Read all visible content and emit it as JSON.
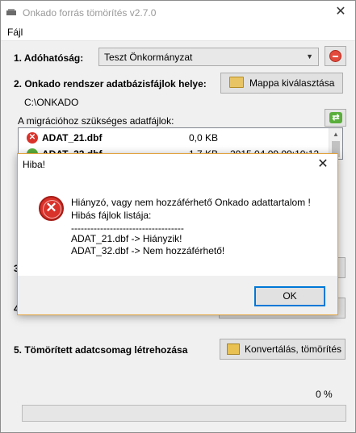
{
  "window": {
    "title": "Onkado forrás tömörítés v2.7.0"
  },
  "menu": {
    "file": "Fájl"
  },
  "step1": {
    "label": "1. Adóhatóság:",
    "selected": "Teszt Önkormányzat"
  },
  "step2": {
    "label": "2. Onkado rendszer adatbázisfájlok helye:",
    "browse_button": "Mappa kiválasztása",
    "path": "C:\\ONKADO"
  },
  "files": {
    "header": "A migrációhoz szükséges adatfájlok:",
    "rows": [
      {
        "name": "ADAT_21.dbf",
        "size": "0,0 KB",
        "date": "",
        "status": "error"
      },
      {
        "name": "ADAT_32.dbf",
        "size": "1,7 KB",
        "date": "2015.04.09 09:10:12",
        "status": "ok"
      }
    ]
  },
  "step3": {
    "label": "3"
  },
  "step4": {
    "label": "4"
  },
  "step5": {
    "label": "5. Tömörített adatcsomag létrehozása",
    "button": "Konvertálás, tömörítés"
  },
  "progress": {
    "percent_text": "0 %",
    "value": 0
  },
  "dialog": {
    "title": "Hiba!",
    "line1": "Hiányzó, vagy nem hozzáférhető Onkado adattartalom !",
    "line2": "Hibás fájlok listája:",
    "separator": "-----------------------------------",
    "line3": "ADAT_21.dbf -> Hiányzik!",
    "line4": "ADAT_32.dbf -> Nem hozzáférhető!",
    "ok": "OK"
  },
  "colors": {
    "dialog_border": "#e3a23a",
    "error_red": "#d9322a",
    "ok_green": "#5aae3b",
    "focus_blue": "#0078d7"
  }
}
